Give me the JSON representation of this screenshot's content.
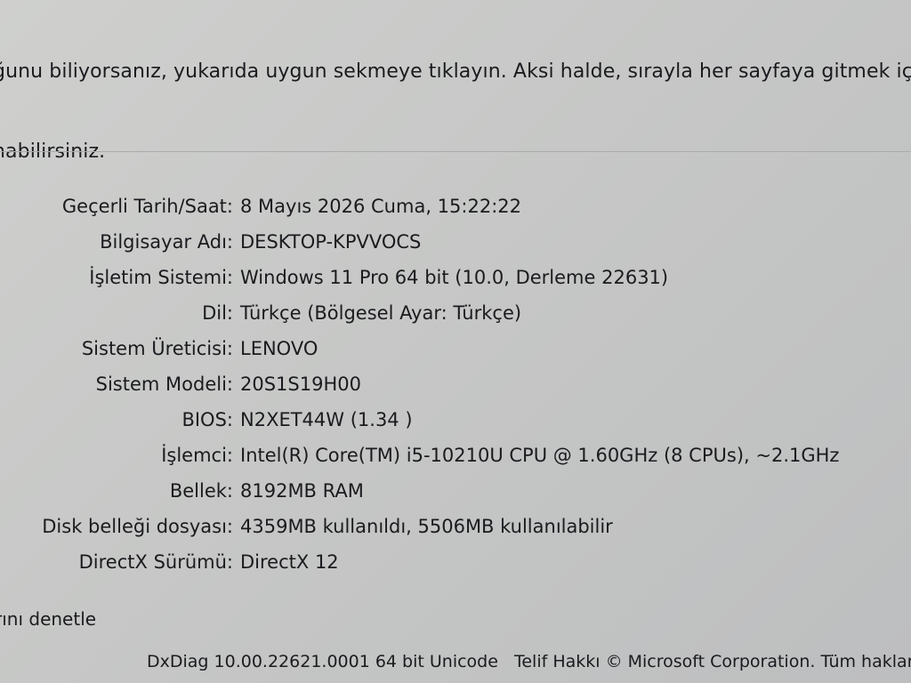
{
  "intro": {
    "line1": "ğunu biliyorsanız, yukarıda uygun sekmeye tıklayın. Aksi halde, sırayla her sayfaya gitmek iç",
    "line2": "nabilirsiniz."
  },
  "system_info": [
    {
      "label": "Geçerli Tarih/Saat:",
      "value": "8 Mayıs 2026 Cuma, 15:22:22"
    },
    {
      "label": "Bilgisayar Adı:",
      "value": "DESKTOP-KPVVOCS"
    },
    {
      "label": "İşletim Sistemi:",
      "value": "Windows 11 Pro 64 bit (10.0, Derleme 22631)"
    },
    {
      "label": "Dil:",
      "value": "Türkçe (Bölgesel Ayar: Türkçe)"
    },
    {
      "label": "Sistem Üreticisi:",
      "value": "LENOVO"
    },
    {
      "label": "Sistem Modeli:",
      "value": "20S1S19H00"
    },
    {
      "label": "BIOS:",
      "value": "N2XET44W (1.34 )"
    },
    {
      "label": "İşlemci:",
      "value": "Intel(R) Core(TM) i5-10210U CPU @ 1.60GHz (8 CPUs), ~2.1GHz"
    },
    {
      "label": "Bellek:",
      "value": "8192MB RAM"
    },
    {
      "label": "Disk belleği dosyası:",
      "value": "4359MB kullanıldı, 5506MB kullanılabilir"
    },
    {
      "label": "DirectX Sürümü:",
      "value": "DirectX 12"
    }
  ],
  "check_link": "rını denetle",
  "footer": {
    "version": "DxDiag 10.00.22621.0001 64 bit Unicode",
    "copyright": "Telif Hakkı © Microsoft Corporation. Tüm hakları"
  }
}
